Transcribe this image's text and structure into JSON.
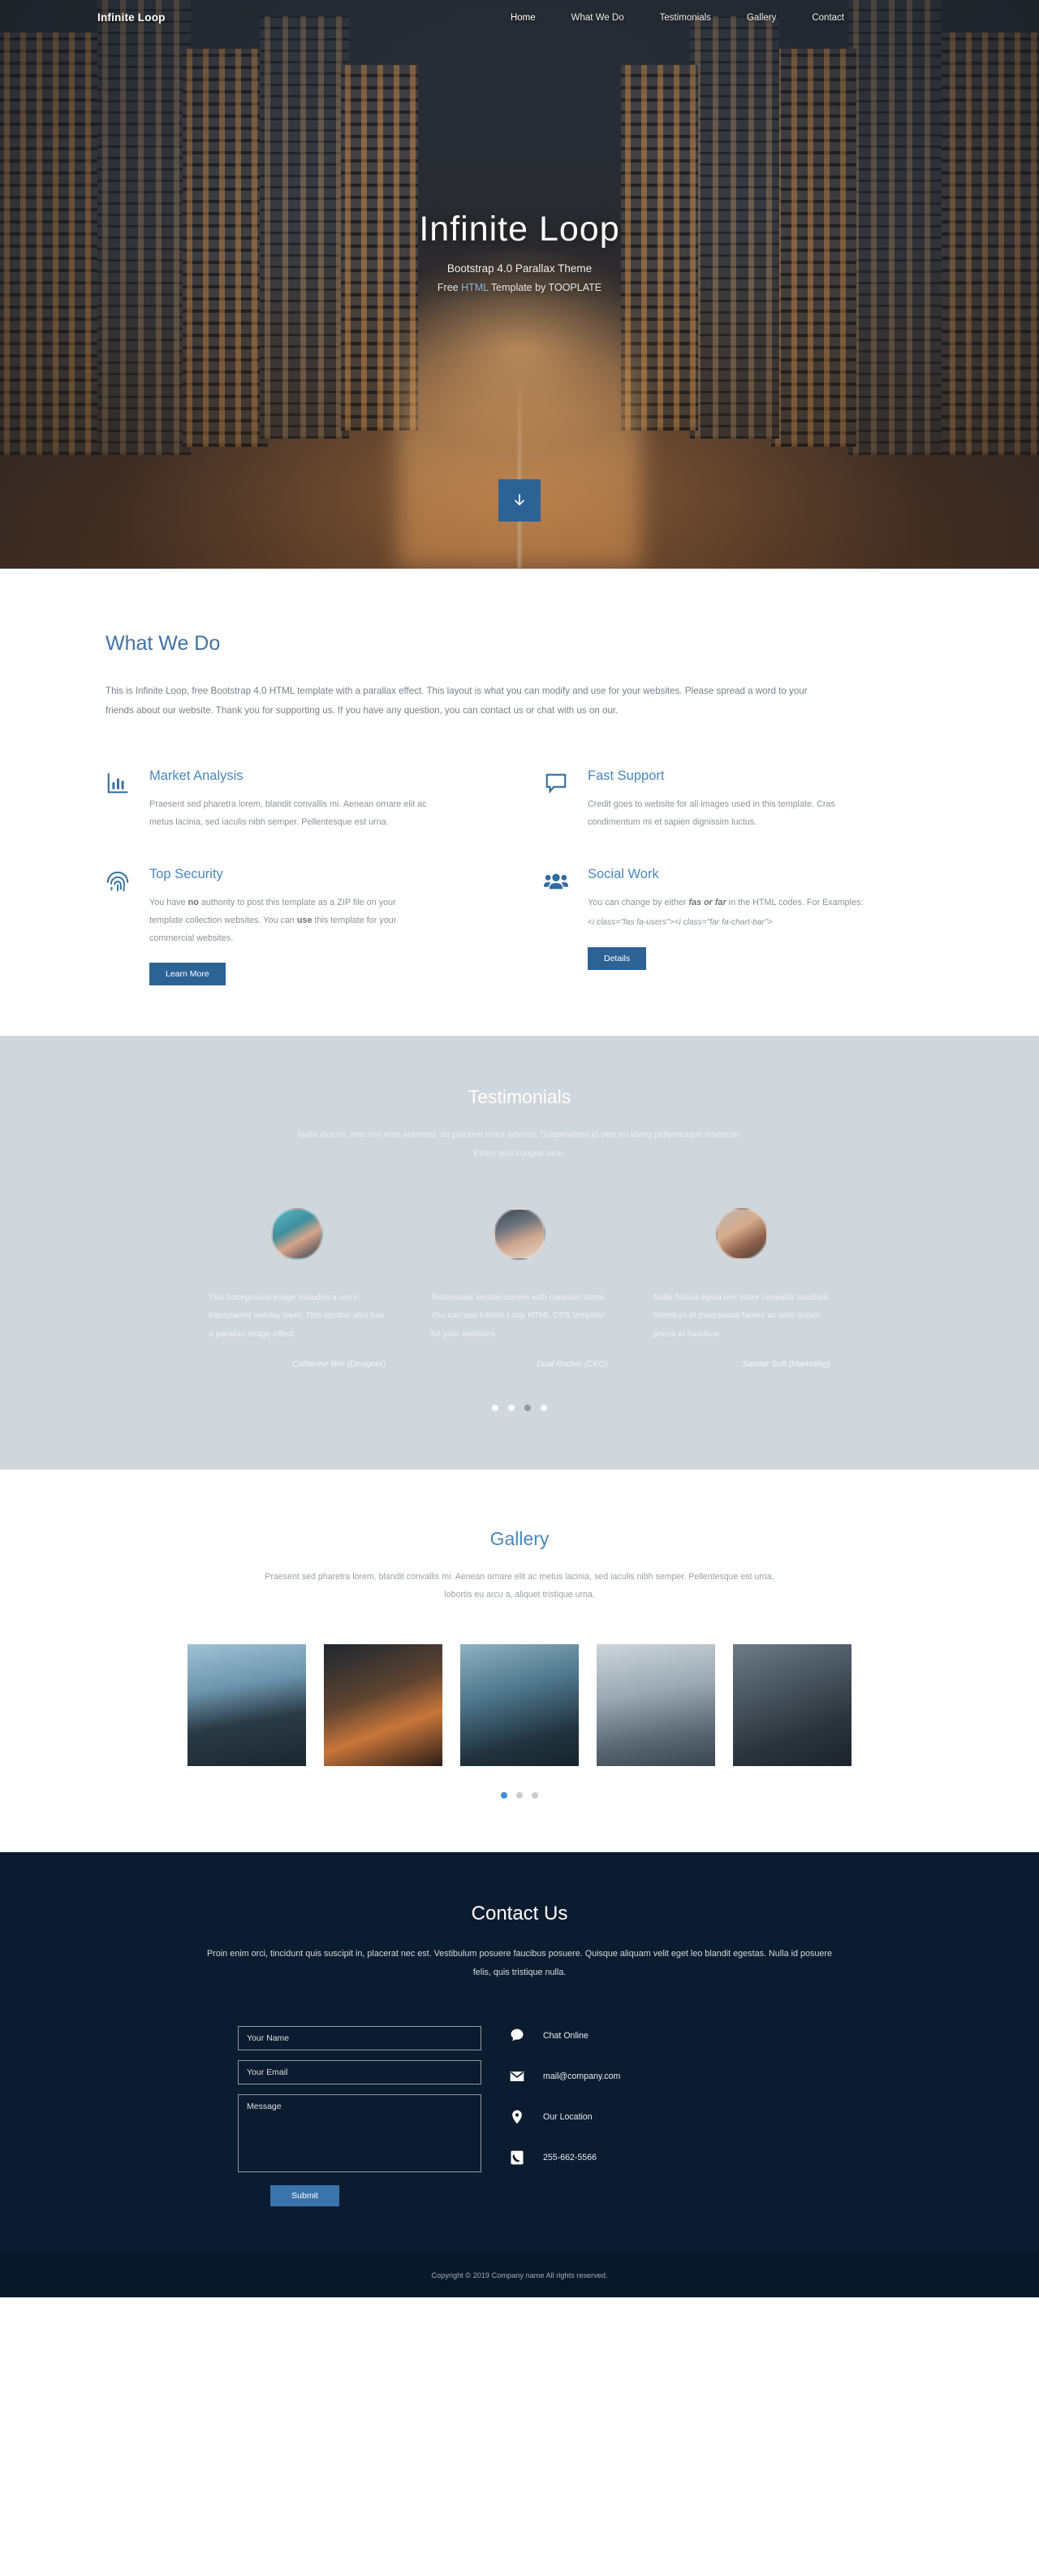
{
  "nav": {
    "brand": "Infinite Loop",
    "items": [
      {
        "label": "Home",
        "active": true
      },
      {
        "label": "What We Do",
        "active": false
      },
      {
        "label": "Testimonials",
        "active": false
      },
      {
        "label": "Gallery",
        "active": false
      },
      {
        "label": "Contact",
        "active": false
      }
    ]
  },
  "hero": {
    "title": "Infinite Loop",
    "subtitle": "Bootstrap 4.0 Parallax Theme",
    "tagline_before": "Free ",
    "tagline_highlight": "HTML",
    "tagline_after": " Template by TOOPLATE",
    "scroll_icon": "arrow-down-icon"
  },
  "what_we_do": {
    "title": "What We Do",
    "intro": "This is Infinite Loop, free Bootstrap 4.0 HTML template with a parallax effect. This layout is what you can modify and use for your websites. Please spread a word to your friends about our website. Thank you for supporting us. If you have any question, you can contact us or chat with us on our.",
    "features": [
      {
        "icon": "chart-bar-icon",
        "title": "Market Analysis",
        "text": "Praesent sed pharetra lorem, blandit convallis mi. Aenean ornare elit ac metus lacinia, sed iaculis nibh semper. Pellentesque est urna."
      },
      {
        "icon": "comment-icon",
        "title": "Fast Support",
        "text": "Credit goes to website for all images used in this template. Cras condimentum mi et sapien dignissim luctus."
      },
      {
        "icon": "fingerprint-icon",
        "title": "Top Security",
        "text_part1": "You have ",
        "text_bold1": "no",
        "text_part2": " authority to post this template as a ZIP file on your template collection websites. You can ",
        "text_bold2": "use",
        "text_part3": " this template for your commercial websites.",
        "button": "Learn More"
      },
      {
        "icon": "users-icon",
        "title": "Social Work",
        "text_part1": "You can change by either ",
        "text_bold1": "fas or far",
        "text_part2": " in the HTML codes. For Examples:",
        "code": "<i class=\"fas fa-users\"><i class=\"far fa-chart-bar\">",
        "button": "Details"
      }
    ]
  },
  "testimonials": {
    "title": "Testimonials",
    "subtitle": "Nulla dictum, rem non eros euismod, eu placerat tortor lobortis. Suspendisse id velit eu libero pellentesque interdum. Etiam quis congue arcu.",
    "items": [
      {
        "avatar": "avatar-catherine",
        "text": "This background image includes a semi-transparent overlay layer. This section also has a parallax image effect.",
        "author": "Catherine Win (Designer)"
      },
      {
        "avatar": "avatar-dual",
        "text": "Testimonial section comes with carousel items. You can use Infinite Loop HTML CSS template for your websites.",
        "author": "Dual Rocker (CEO)"
      },
      {
        "avatar": "avatar-sandar",
        "text": "Nulla finibus ligula nec tortor convallis tincidunt. Interdum et malesuada fames ac ante ipsum primis in faucibus.",
        "author": "Sandar Soft (Marketing)"
      }
    ],
    "dots": [
      {
        "active": false
      },
      {
        "active": false
      },
      {
        "active": true
      },
      {
        "active": false
      }
    ]
  },
  "gallery": {
    "title": "Gallery",
    "subtitle": "Praesent sed pharetra lorem, blandit convallis mi. Aenean ornare elit ac metus lacinia, sed iaculis nibh semper. Pellentesque est urna, lobortis eu arcu a, aliquet tristique urna.",
    "items": [
      {
        "name": "gallery-image-1"
      },
      {
        "name": "gallery-image-2"
      },
      {
        "name": "gallery-image-3"
      },
      {
        "name": "gallery-image-4"
      },
      {
        "name": "gallery-image-5"
      }
    ],
    "dots": [
      {
        "active": true
      },
      {
        "active": false
      },
      {
        "active": false
      }
    ]
  },
  "contact": {
    "title": "Contact Us",
    "subtitle": "Proin enim orci, tincidunt quis suscipit in, placerat nec est. Vestibulum posuere faucibus posuere. Quisque aliquam velit eget leo blandit egestas. Nulla id posuere felis, quis tristique nulla.",
    "form": {
      "name_placeholder": "Your Name",
      "name_value": "",
      "email_placeholder": "Your Email",
      "email_value": "",
      "message_placeholder": "Message",
      "message_value": "",
      "submit_label": "Submit"
    },
    "info": [
      {
        "icon": "chat-icon",
        "label": "Chat Online"
      },
      {
        "icon": "envelope-icon",
        "label": "mail@company.com"
      },
      {
        "icon": "map-pin-icon",
        "label": "Our Location"
      },
      {
        "icon": "phone-icon",
        "label": "255-662-5566"
      }
    ]
  },
  "footer": {
    "copyright": "Copyright © 2019 Company name All rights reserved."
  },
  "colors": {
    "accent": "#2d6295",
    "heading": "#4a87bd",
    "contact_bg": "#0b1c30",
    "testimonial_bg": "#cfd6dc"
  }
}
